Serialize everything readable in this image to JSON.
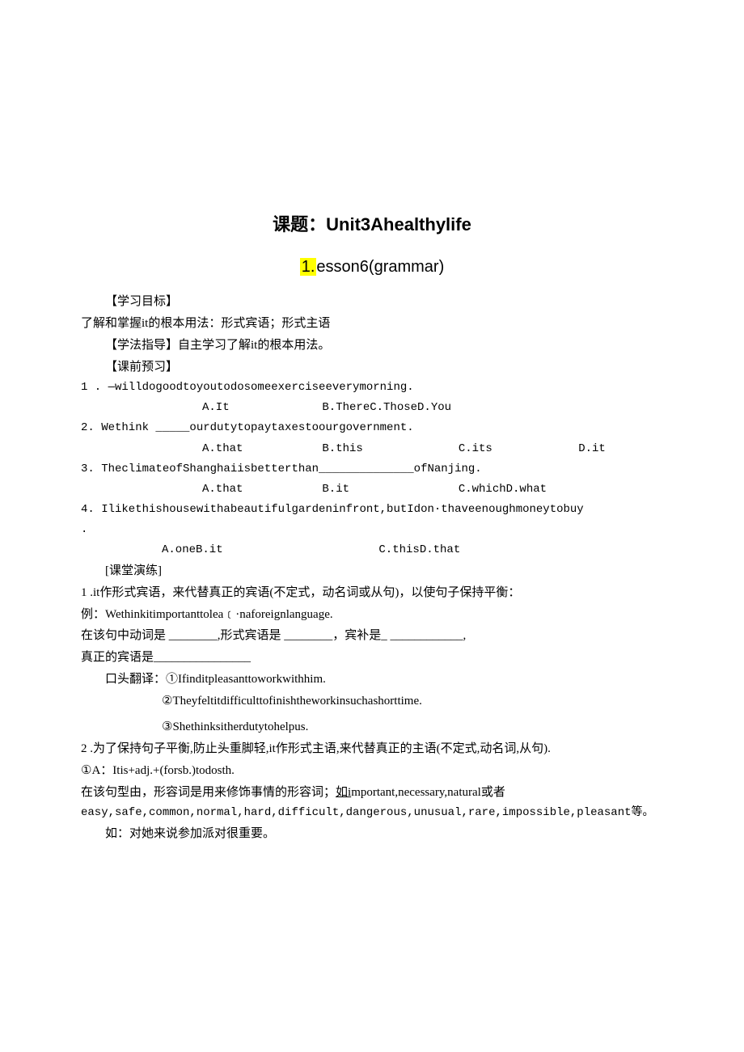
{
  "title1": "课题：Unit3Ahealthylife",
  "title2_num": "1.",
  "title2_rest": "esson6(grammar)",
  "sec1": "【学习目标】",
  "goal": "了解和掌握it的根本用法：形式宾语；形式主语",
  "sec2": "【学法指导】自主学习了解it的根本用法。",
  "sec3": "【课前预习】",
  "q1": "1 . —willdogoodtoyoutodosomeexerciseeverymorning.",
  "q1a": "A.It",
  "q1b": "B.ThereC.ThoseD.You",
  "q2": "2.  Wethink _____ourdutytopaytaxestoourgovernment.",
  "q2a": "A.that",
  "q2b": "B.this",
  "q2c": "C.its",
  "q2d": "D.it",
  "q3": "3.  TheclimateofShanghaiisbetterthan______________ofNanjing.",
  "q3a": "A.that",
  "q3b": "B.it",
  "q3c": "C.whichD.what",
  "q4": "4.   Ilikethishousewithabeautifulgardeninfront,butIdon·thaveenoughmoneytobuy",
  "q4dot": ".",
  "q4a": "A.oneB.it",
  "q4c": "C.thisD.that",
  "sec4": "[课堂演练]",
  "p1a": "1    .it作形式宾语，来代替真正的宾语(不定式，动名词或从句)，以使句子保持平衡：",
  "p1b": "例：Wethinkitimportanttolea﹝·naforeignlanguage.",
  "p1c": "在该句中动词是 ________,形式宾语是 ________，宾补是_ ____________,",
  "p1d": "真正的宾语是________________",
  "oral_lbl": "口头翻译：①Ifinditpleasanttoworkwithhim.",
  "oral2": "②Theyfeltitdifficulttofinishtheworkinsuchashorttime.",
  "oral3": "③Shethinksitherdutytohelpus.",
  "p2a": "2    .为了保持句子平衡,防止头重脚轻,it作形式主语,来代替真正的主语(不定式,动名词,从句).",
  "p2b": "①A：Itis+adj.+(forsb.)todosth.",
  "p2c_a": "在该句型由，形容词是用来修饰事情的形容词；",
  "p2c_b": "如i",
  "p2c_c": "mportant,necessary,natural或者",
  "p2d": "easy,safe,common,normal,hard,difficult,dangerous,unusual,rare,impossible,pleasant等。",
  "p2e": "如：对她来说参加派对很重要。"
}
